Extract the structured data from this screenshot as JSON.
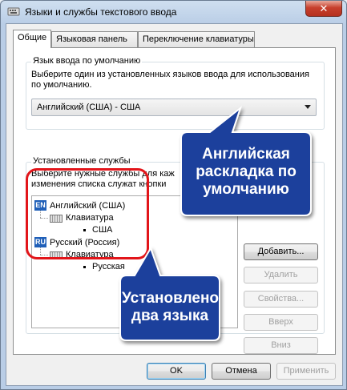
{
  "window": {
    "title": "Языки и службы текстового ввода",
    "close_glyph": "✕"
  },
  "tabs": [
    {
      "label": "Общие",
      "active": true
    },
    {
      "label": "Языковая панель",
      "active": false
    },
    {
      "label": "Переключение клавиатуры",
      "active": false
    }
  ],
  "default_language": {
    "group_title": "Язык ввода по умолчанию",
    "description": "Выберите один из установленных языков ввода для использования по умолчанию.",
    "selected": "Английский (США) - США"
  },
  "installed_services": {
    "group_title": "Установленные службы",
    "description_line1": "Выберите нужные службы для каж",
    "description_line2": "изменения списка служат кнопки",
    "tree": [
      {
        "badge": "EN",
        "label": "Английский (США)",
        "keyboard_label": "Клавиатура",
        "layout": "США"
      },
      {
        "badge": "RU",
        "label": "Русский (Россия)",
        "keyboard_label": "Клавиатура",
        "layout": "Русская"
      }
    ],
    "buttons": {
      "add": "Добавить...",
      "remove": "Удалить",
      "properties": "Свойства...",
      "up": "Вверх",
      "down": "Вниз"
    }
  },
  "footer": {
    "ok": "OK",
    "cancel": "Отмена",
    "apply": "Применить"
  },
  "annotations": {
    "callout_top_line1": "Английская",
    "callout_top_line2": "раскладка по",
    "callout_top_line3": "умолчанию",
    "callout_bottom_line1": "Установлено",
    "callout_bottom_line2": "два языка"
  },
  "colors": {
    "callout_fill": "#1e3f9c",
    "highlight_red": "#e2151a",
    "lang_badge": "#1f5fb8"
  }
}
